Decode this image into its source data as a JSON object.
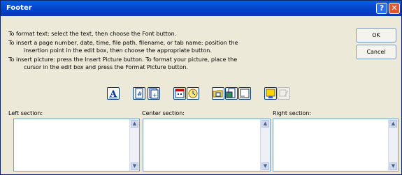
{
  "window": {
    "title": "Footer"
  },
  "titlebar": {
    "help_label": "?",
    "close_label": "✕"
  },
  "instructions": [
    "To format text:  select the text, then choose the Font button.",
    "To insert a page number, date, time, file path, filename, or tab name:  position the",
    "insertion point in the edit box, then choose the appropriate button.",
    "To insert picture: press the Insert Picture button.  To format your picture, place the",
    "cursor in the edit box and press the Format Picture button."
  ],
  "buttons": {
    "ok": "OK",
    "cancel": "Cancel"
  },
  "toolbar_icons": [
    "font-icon",
    "page-number-icon",
    "total-pages-icon",
    "date-icon",
    "time-icon",
    "file-path-icon",
    "filename-icon",
    "sheet-name-icon",
    "insert-picture-icon",
    "format-picture-icon"
  ],
  "sections": {
    "left": "Left section:",
    "center": "Center section:",
    "right": "Right section:"
  },
  "scrollbar": {
    "up": "▲",
    "down": "▼"
  }
}
